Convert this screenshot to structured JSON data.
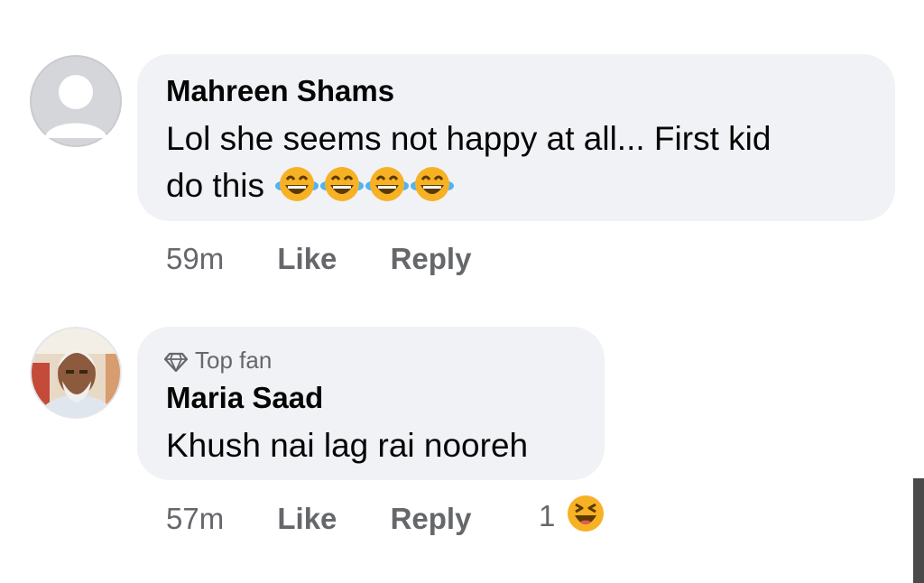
{
  "comments": [
    {
      "author": "Mahreen Shams",
      "text_line1": "Lol she seems not happy at all... First kid",
      "text_line2": "do this",
      "time": "59m",
      "like_label": "Like",
      "reply_label": "Reply",
      "avatar_icon": "default-user-icon",
      "emojis": [
        "tears-of-joy-icon",
        "tears-of-joy-icon",
        "tears-of-joy-icon",
        "tears-of-joy-icon"
      ]
    },
    {
      "badge_label": "Top fan",
      "badge_icon": "diamond-icon",
      "author": "Maria Saad",
      "text": "Khush nai lag rai nooreh",
      "time": "57m",
      "like_label": "Like",
      "reply_label": "Reply",
      "reaction_count": "1",
      "reaction_icon": "laughing-emoji-icon",
      "avatar_icon": "profile-photo"
    }
  ],
  "colors": {
    "bubble": "#f0f2f5",
    "text": "#050505",
    "meta": "#65676b",
    "emoji_yellow": "#f7b125"
  }
}
